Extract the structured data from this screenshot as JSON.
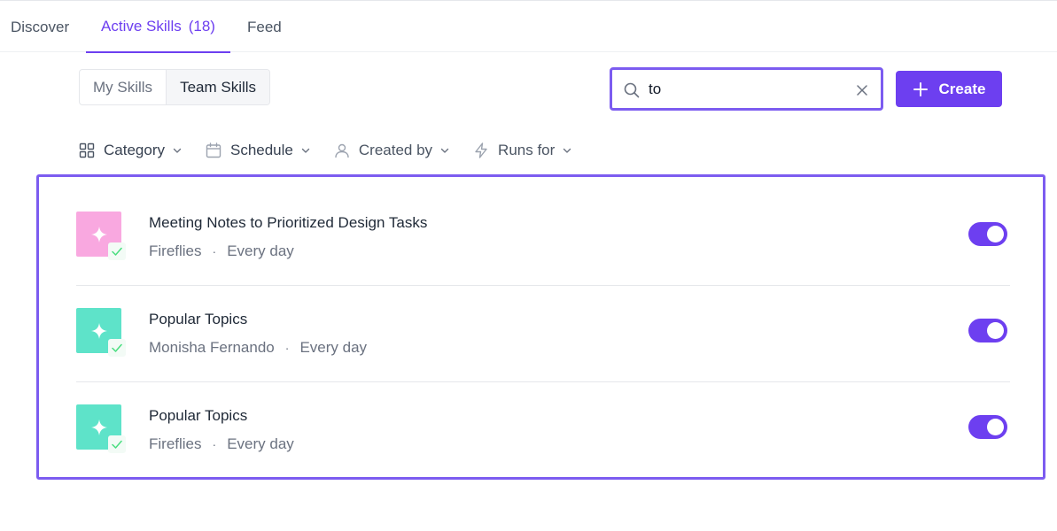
{
  "tabs": {
    "discover": "Discover",
    "active_label": "Active Skills",
    "active_count": "(18)",
    "feed": "Feed"
  },
  "segments": {
    "my_skills": "My Skills",
    "team_skills": "Team Skills",
    "selected": "Team Skills"
  },
  "search": {
    "value": "to",
    "icon": "search-icon",
    "clear_icon": "close-icon"
  },
  "create_button": {
    "label": "Create",
    "icon": "plus-icon"
  },
  "filters": {
    "category": "Category",
    "schedule": "Schedule",
    "created_by": "Created by",
    "runs_for": "Runs for"
  },
  "skills": [
    {
      "title": "Meeting Notes to Prioritized Design Tasks",
      "source": "Fireflies",
      "schedule": "Every day",
      "thumb_color": "#f9a8e0",
      "enabled": true
    },
    {
      "title": "Popular Topics",
      "source": "Monisha Fernando",
      "schedule": "Every day",
      "thumb_color": "#5ee3c9",
      "enabled": true
    },
    {
      "title": "Popular Topics",
      "source": "Fireflies",
      "schedule": "Every day",
      "thumb_color": "#5ee3c9",
      "enabled": true
    }
  ],
  "colors": {
    "accent": "#6d3ff0",
    "highlight_border": "#7c5cf0",
    "pink_thumb": "#f9a8e0",
    "teal_thumb": "#5ee3c9",
    "check": "#4ade80"
  }
}
